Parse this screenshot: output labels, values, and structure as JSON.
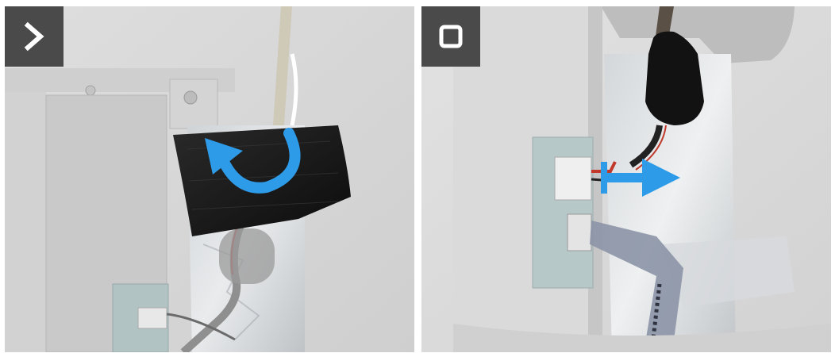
{
  "left_panel": {
    "badge_icon": "chevron-right-icon",
    "arrow_icon": "curved-arrow-icon",
    "arrow_color": "#2e9be8"
  },
  "right_panel": {
    "badge_icon": "square-stop-icon",
    "arrow_icon": "pull-arrow-icon",
    "arrow_color": "#2e9be8"
  },
  "colors": {
    "badge_background": "#4a4a4a",
    "badge_icon": "#ffffff"
  }
}
